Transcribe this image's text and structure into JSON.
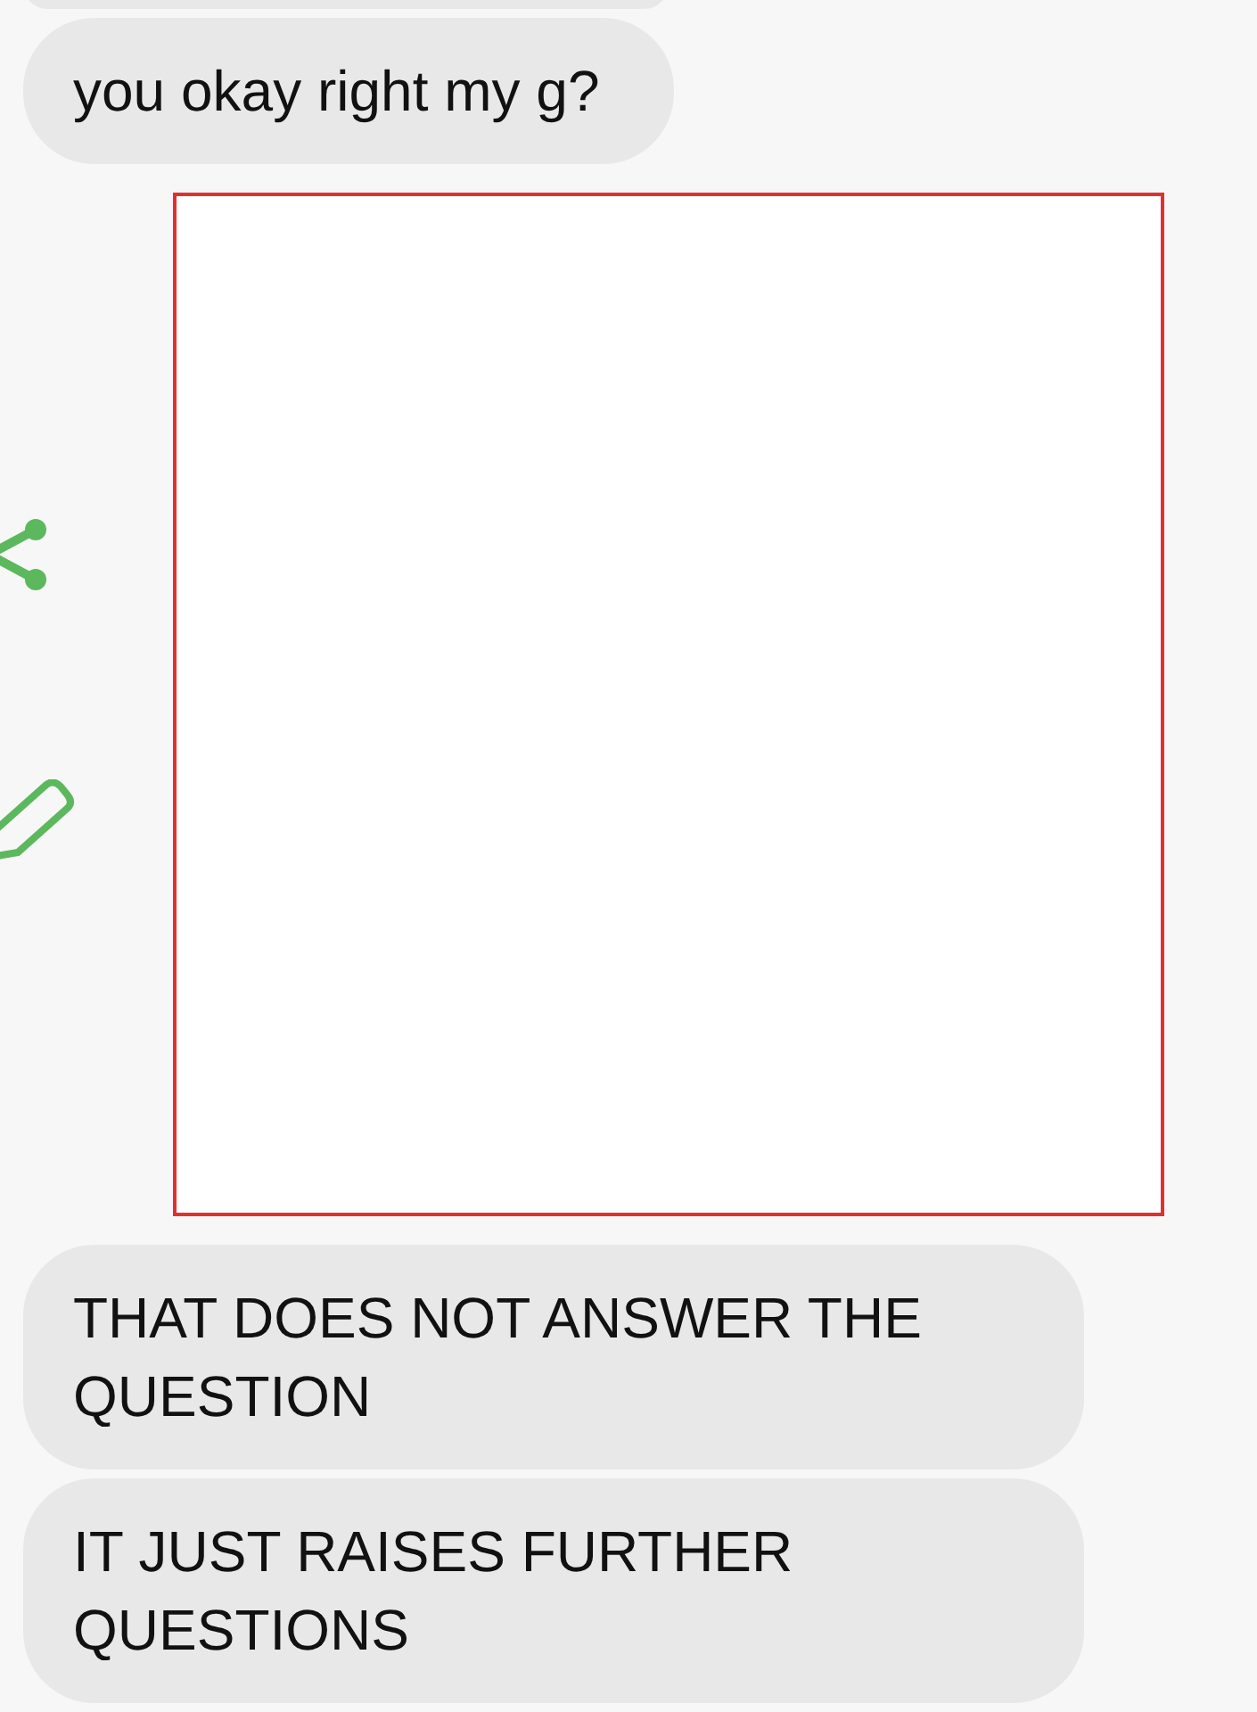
{
  "messages": [
    {
      "kind": "partial"
    },
    {
      "kind": "text",
      "text": "you okay right my g?"
    },
    {
      "kind": "image"
    },
    {
      "kind": "text",
      "text": "THAT DOES NOT ANSWER THE QUESTION"
    },
    {
      "kind": "text",
      "text": "IT JUST RAISES FURTHER QUESTIONS"
    }
  ]
}
